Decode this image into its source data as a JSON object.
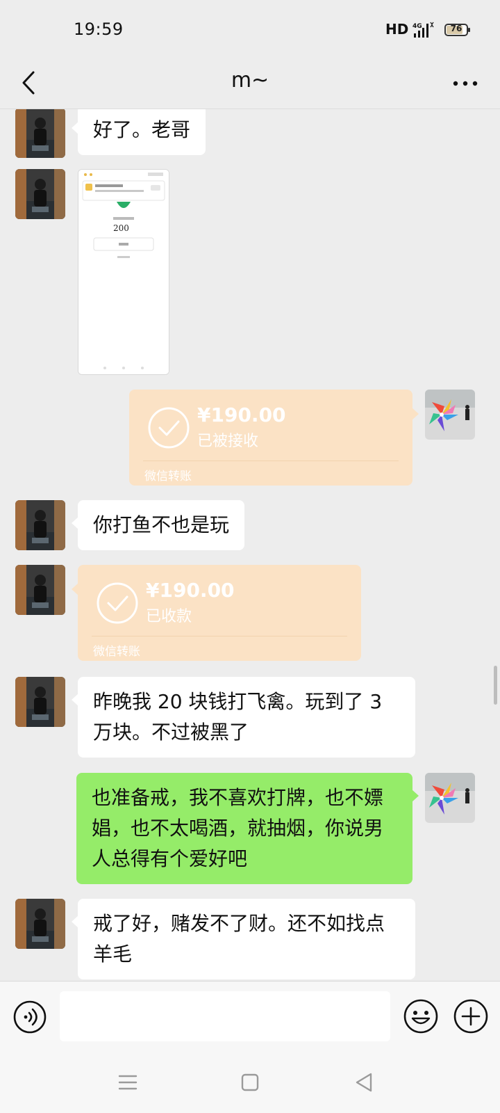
{
  "status_bar": {
    "time": "19:59",
    "hd": "HD",
    "network": "4G",
    "battery": "76",
    "battery_level": 0.76
  },
  "header": {
    "title": "m~"
  },
  "messages": [
    {
      "sender": "other",
      "type": "text",
      "text": "好了。老哥"
    },
    {
      "sender": "other",
      "type": "image",
      "image_icon": "screenshot-thumbnail",
      "thumb_amount": "200"
    },
    {
      "sender": "me",
      "type": "transfer",
      "amount": "¥190.00",
      "status": "已被接收",
      "footer": "微信转账"
    },
    {
      "sender": "other",
      "type": "text",
      "text": "你打鱼不也是玩"
    },
    {
      "sender": "other",
      "type": "transfer",
      "amount": "¥190.00",
      "status": "已收款",
      "footer": "微信转账"
    },
    {
      "sender": "other",
      "type": "text",
      "text": "昨晚我 20 块钱打飞禽。玩到了 3 万块。不过被黑了"
    },
    {
      "sender": "me",
      "type": "text",
      "text": "也准备戒，我不喜欢打牌，也不嫖娼，也不太喝酒，就抽烟，你说男人总得有个爱好吧"
    },
    {
      "sender": "other",
      "type": "text",
      "text": "戒了好，赌发不了财。还不如找点羊毛"
    }
  ],
  "input_bar": {
    "value": "",
    "placeholder": "",
    "voice_icon": "voice-icon",
    "emoji_icon": "emoji-icon",
    "plus_icon": "plus-icon"
  },
  "colors": {
    "background": "#ededed",
    "bubble_self": "#95ec69",
    "bubble_other": "#ffffff",
    "transfer_card": "#fbe2c5"
  }
}
